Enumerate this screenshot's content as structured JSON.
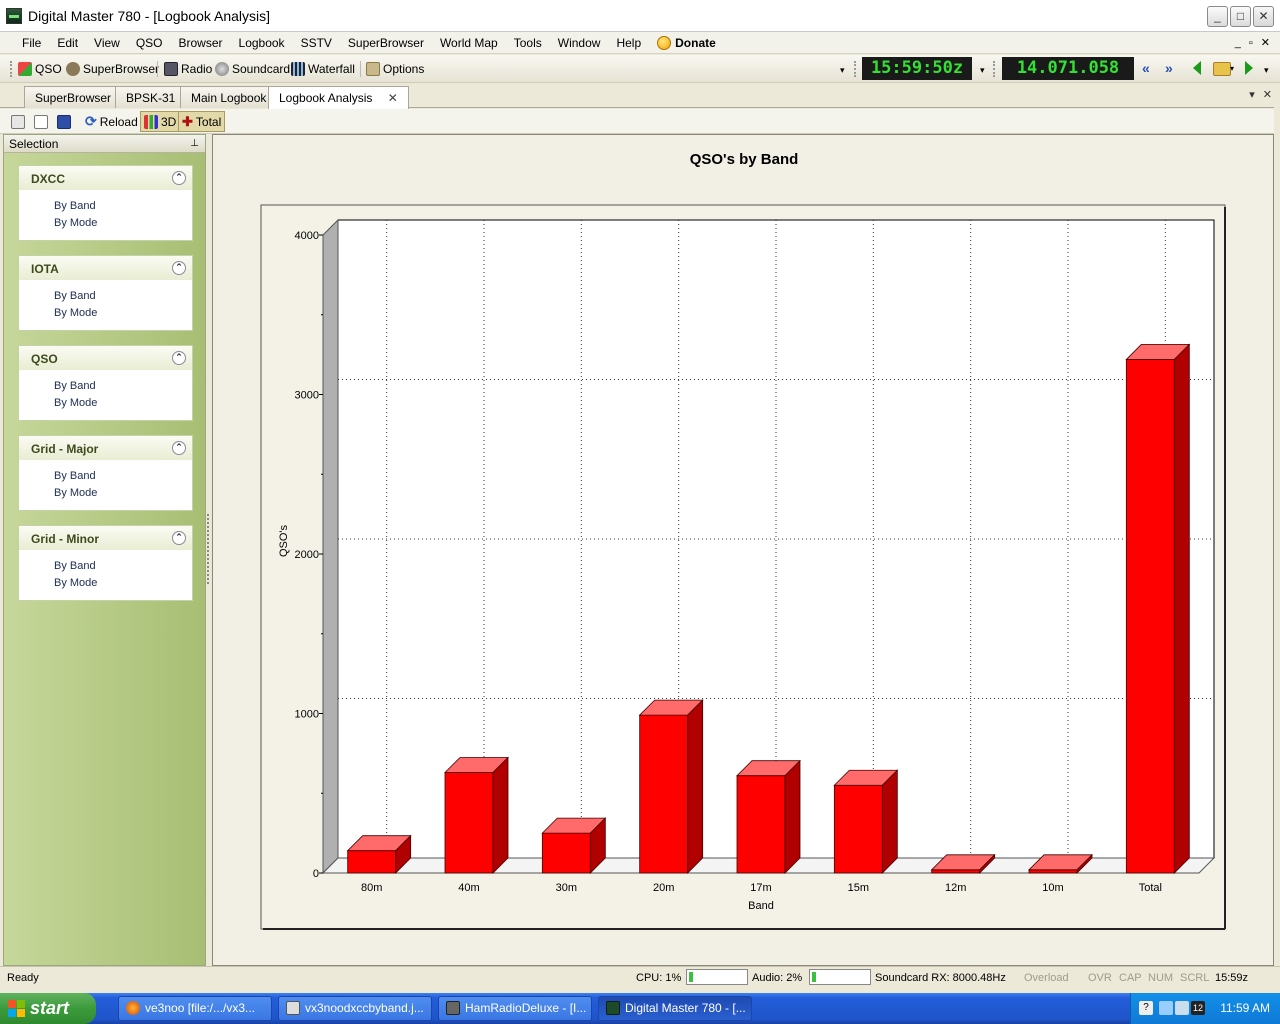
{
  "window": {
    "title": "Digital Master 780 - [Logbook Analysis]",
    "min": "_",
    "max": "□",
    "close": "✕"
  },
  "menu": [
    "File",
    "Edit",
    "View",
    "QSO",
    "Browser",
    "Logbook",
    "SSTV",
    "SuperBrowser",
    "World Map",
    "Tools",
    "Window",
    "Help"
  ],
  "donate": "Donate",
  "mdi_buttons": [
    "_",
    "▫",
    "✕"
  ],
  "toolbar": {
    "qso": "QSO",
    "superbrowser": "SuperBrowser",
    "radio": "Radio",
    "soundcard": "Soundcard",
    "waterfall": "Waterfall",
    "options": "Options",
    "clock": "15:59:50z",
    "frequency": "14.071.058",
    "rewind": "«",
    "forward": "»"
  },
  "tabs": [
    "SuperBrowser",
    "BPSK-31",
    "Main Logbook",
    "Logbook Analysis"
  ],
  "tab_close": "✕",
  "tab_tools": [
    "▾",
    "✕"
  ],
  "chart_toolbar": {
    "reload": "Reload",
    "three_d": "3D",
    "total": "Total"
  },
  "selection_panel": {
    "title": "Selection",
    "pin": "⊥",
    "groups": [
      {
        "name": "DXCC",
        "items": [
          "By Band",
          "By Mode"
        ]
      },
      {
        "name": "IOTA",
        "items": [
          "By Band",
          "By Mode"
        ]
      },
      {
        "name": "QSO",
        "items": [
          "By Band",
          "By Mode"
        ]
      },
      {
        "name": "Grid - Major",
        "items": [
          "By Band",
          "By Mode"
        ]
      },
      {
        "name": "Grid - Minor",
        "items": [
          "By Band",
          "By Mode"
        ]
      }
    ],
    "collapse_glyph": "⌃"
  },
  "chart_data": {
    "type": "bar",
    "title": "QSO's by Band",
    "xlabel": "Band",
    "ylabel": "QSO's",
    "categories": [
      "80m",
      "40m",
      "30m",
      "20m",
      "17m",
      "15m",
      "12m",
      "10m",
      "Total"
    ],
    "values": [
      140,
      630,
      250,
      990,
      610,
      550,
      20,
      20,
      3220
    ],
    "ylim": [
      0,
      4000
    ],
    "yticks": [
      0,
      1000,
      2000,
      3000,
      4000
    ],
    "y_minor_step": 500,
    "grid": true,
    "three_d": true,
    "bar_color": "#ff0000"
  },
  "status": {
    "ready": "Ready",
    "cpu": "CPU: 1%",
    "audio": "Audio: 2%",
    "soundcard": "Soundcard RX: 8000.48Hz",
    "overload": "Overload",
    "ovr": "OVR",
    "cap": "CAP",
    "num": "NUM",
    "scrl": "SCRL",
    "time": "15:59z"
  },
  "taskbar": {
    "start": "start",
    "buttons": [
      "ve3noo [file:/.../vx3...",
      "vx3noodxccbyband.j...",
      "HamRadioDeluxe - [I...",
      "Digital Master 780 - [..."
    ],
    "tray_time": "11:59 AM",
    "tray_badge": "12"
  }
}
